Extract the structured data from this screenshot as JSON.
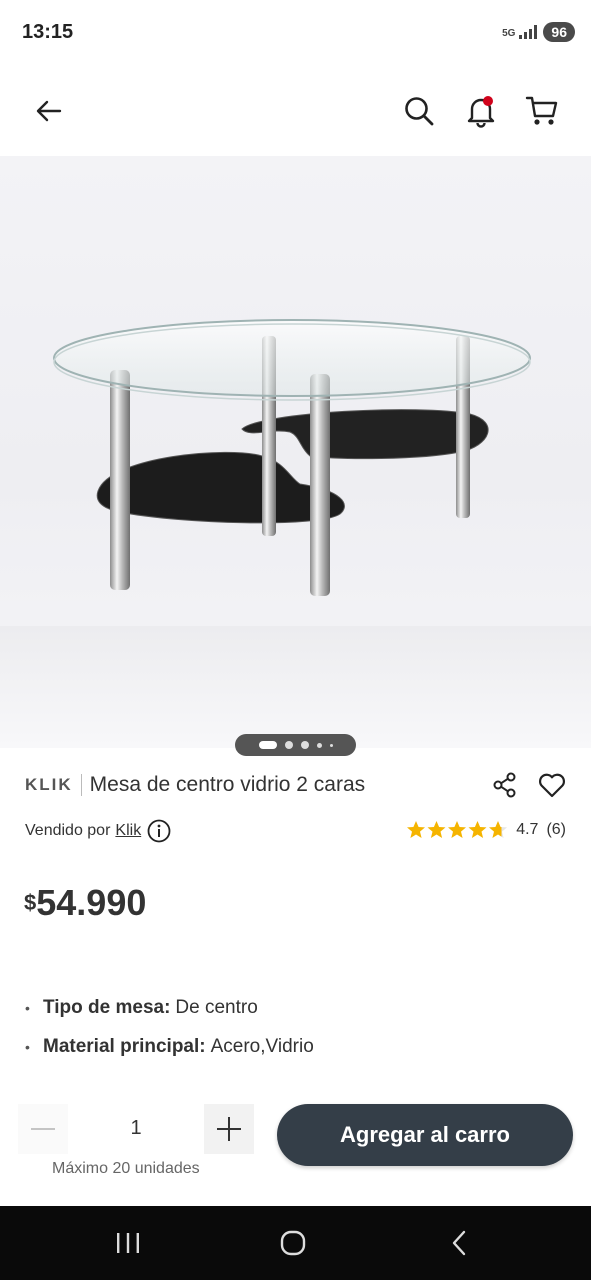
{
  "status_bar": {
    "time": "13:15",
    "network": "5G",
    "battery": "96"
  },
  "header": {
    "back_icon": "arrow-left-icon",
    "search_icon": "search-icon",
    "notifications_icon": "bell-icon",
    "notifications_dot_color": "#d0021b",
    "cart_icon": "cart-icon"
  },
  "gallery": {
    "image_description_icon": "glass-coffee-table-image",
    "page_count": 5,
    "active_page": 1
  },
  "product": {
    "brand": "KLIK",
    "title": "Mesa de centro vidrio 2 caras",
    "sold_by_label": "Vendido por",
    "seller": "Klik",
    "rating_value": "4.7",
    "rating_count": "(6)",
    "rating_stars": 4.7,
    "star_color": "#f5b400",
    "price_currency": "$",
    "price_value": "54.990",
    "specs": [
      {
        "key": "Tipo de mesa:",
        "value": "De centro"
      },
      {
        "key": "Material principal:",
        "value": "Acero,Vidrio"
      }
    ]
  },
  "purchase": {
    "quantity": "1",
    "max_note": "Máximo 20 unidades",
    "add_to_cart_label": "Agregar al carro",
    "button_color": "#343e48"
  },
  "nav": {
    "recents_icon": "recents-icon",
    "home_icon": "home-icon",
    "back_icon": "back-chevron-icon"
  }
}
